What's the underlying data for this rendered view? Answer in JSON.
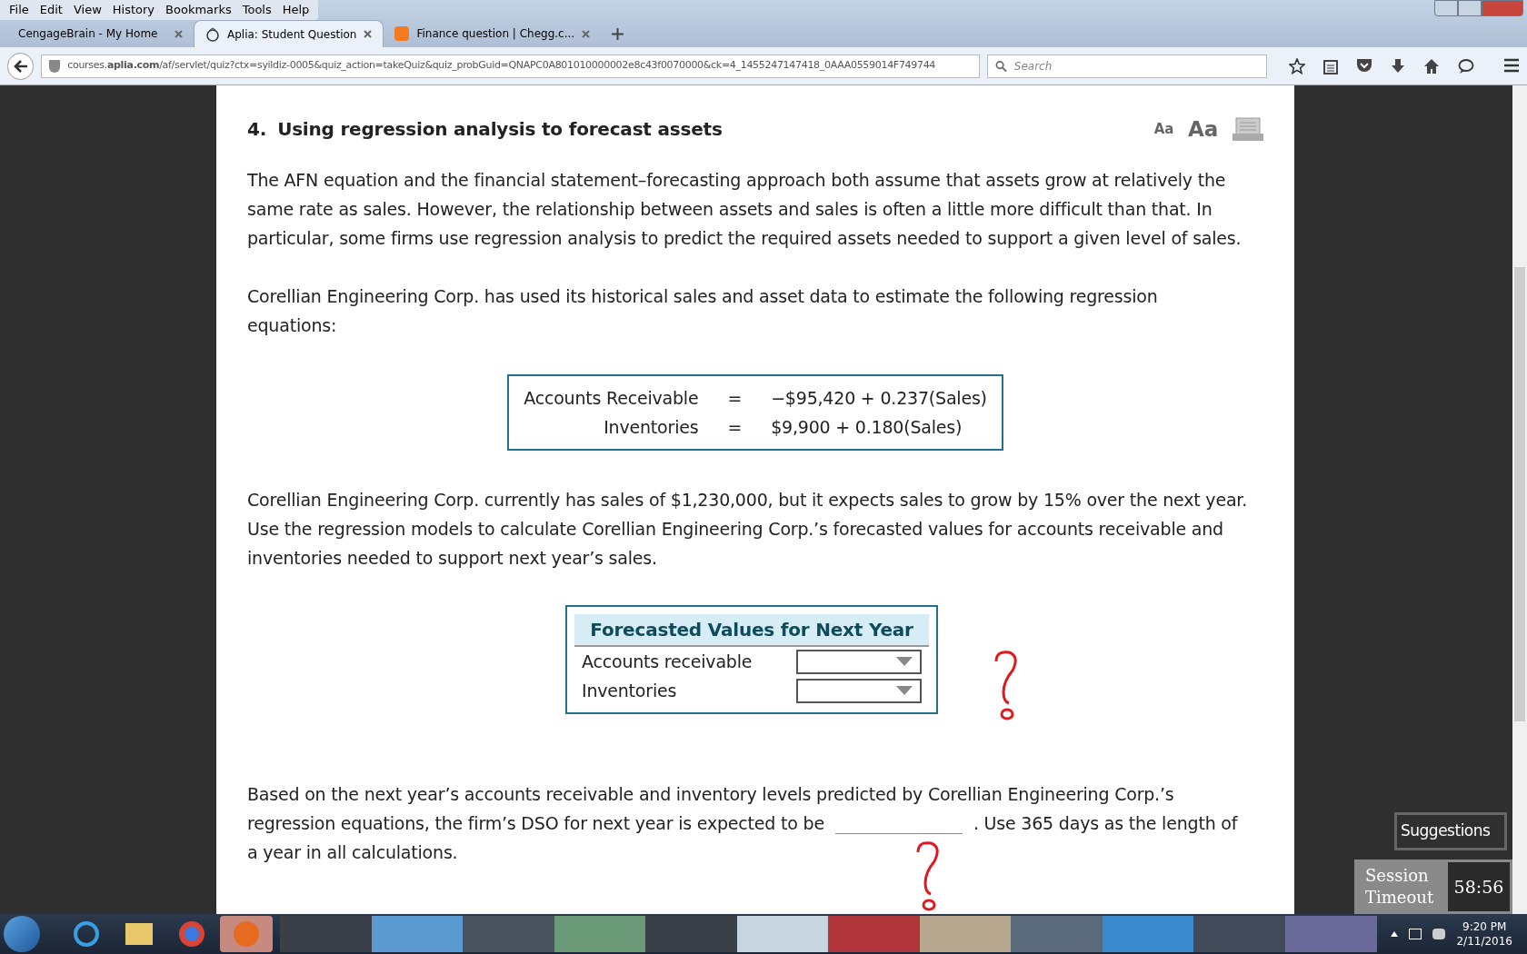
{
  "menu": [
    "File",
    "Edit",
    "View",
    "History",
    "Bookmarks",
    "Tools",
    "Help"
  ],
  "tabs": [
    {
      "label": "CengageBrain - My Home",
      "selected": false,
      "kind": "plain"
    },
    {
      "label": "Aplia: Student Question",
      "selected": true,
      "kind": "aplia"
    },
    {
      "label": "Finance question | Chegg.c...",
      "selected": false,
      "kind": "chegg"
    }
  ],
  "address": "courses.**aplia.com**/af/servlet/quiz?ctx=syildiz-0005&quiz_action=takeQuiz&quiz_probGuid=QNAPC0A801010000002e8c43f0070000&ck=4_1455247147418_0AAA0559014F749744",
  "search": {
    "placeholder": "Search"
  },
  "question": {
    "number": "4.",
    "title": "Using regression analysis to forecast assets",
    "font_buttons": [
      "Aa",
      "Aa"
    ],
    "intro": [
      "The AFN equation and the financial statement–forecasting approach both assume that assets grow at relatively the same rate as sales. However, the relationship between assets and sales is often a little more difficult than that. In particular, some firms use regression analysis to predict the required assets needed to support a given level of sales.",
      "Corellian Engineering Corp. has used its historical sales and asset data to estimate the following regression equations:"
    ],
    "equations": [
      {
        "label": "Accounts Receivable",
        "sign": "=",
        "expression": "−$95,420 + 0.237(Sales)"
      },
      {
        "label": "Inventories",
        "sign": "=",
        "expression": "$9,900 + 0.180(Sales)"
      }
    ],
    "task": "Corellian Engineering Corp. currently has sales of $1,230,000, but it expects sales to grow by 15% over the next year. Use the regression models to calculate Corellian Engineering Corp.’s forecasted values for accounts receivable and inventories needed to support next year’s sales.",
    "table": {
      "title": "Forecasted Values for Next Year",
      "rows": [
        {
          "label": "Accounts receivable"
        },
        {
          "label": "Inventories"
        }
      ]
    },
    "final": {
      "before": [
        "Based on the next year’s accounts receivable and inventory levels predicted by Corellian Engineering Corp.’s",
        "regression equations, the firm’s DSO for next year is expected to be"
      ],
      "after": [
        ". Use 365 days as the length of",
        "a year in all calculations."
      ]
    }
  },
  "suggestions": "Suggestions",
  "session": {
    "label": "Session Timeout",
    "time": "58:56"
  },
  "clock": {
    "time": "9:20 PM",
    "date": "2/11/2016"
  }
}
